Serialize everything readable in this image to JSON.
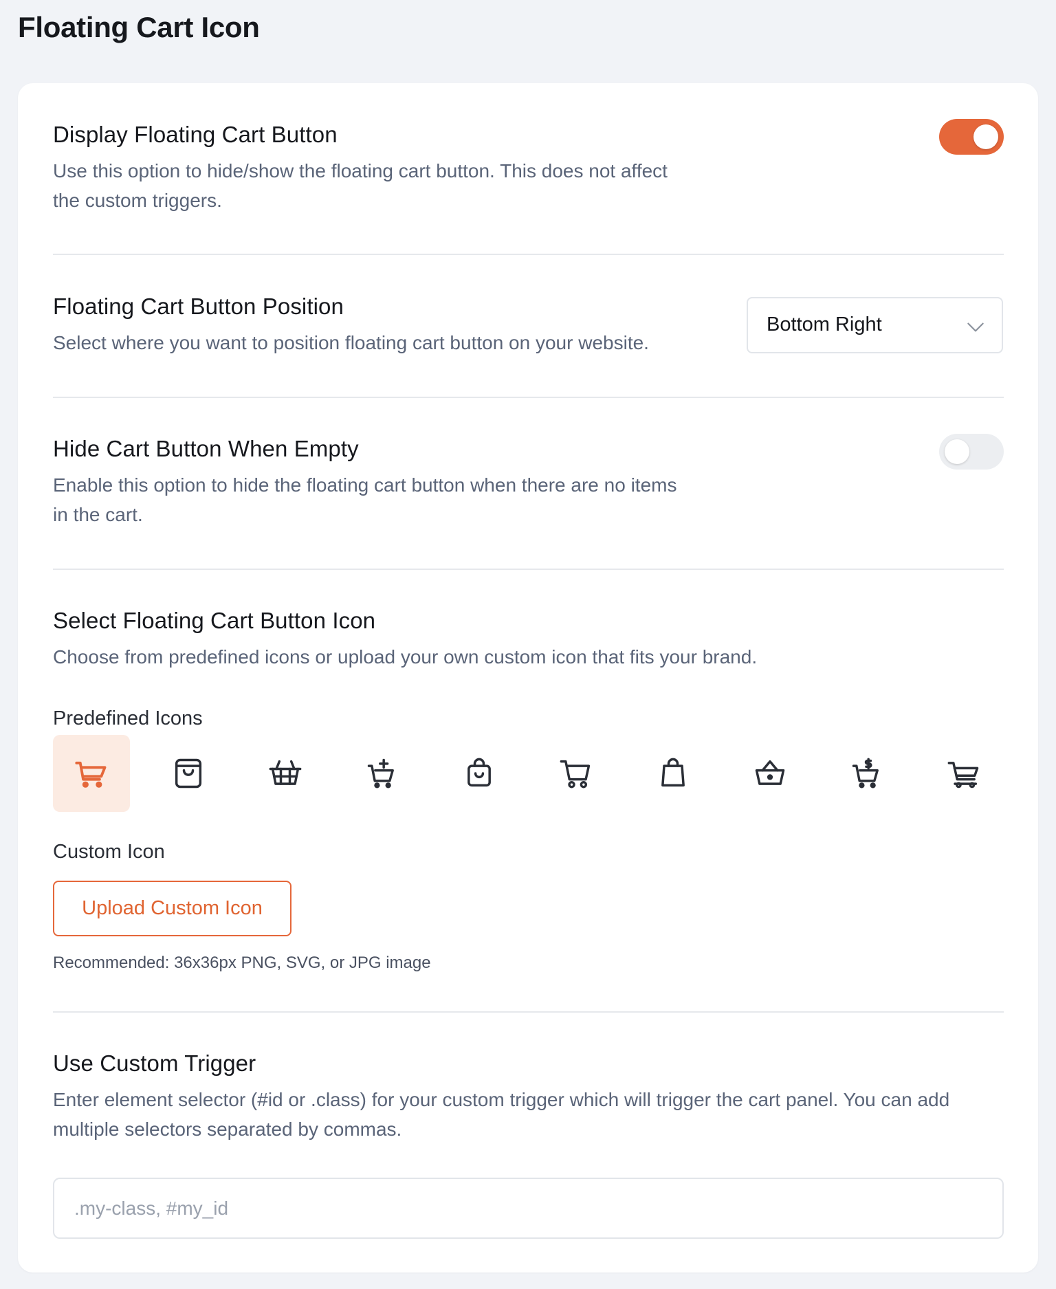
{
  "page": {
    "title": "Floating Cart Icon"
  },
  "colors": {
    "accent": "#e5673a",
    "accent_light": "#fcebe2",
    "muted_text": "#5a6478",
    "background": "#f1f3f7"
  },
  "display_button": {
    "title": "Display Floating Cart Button",
    "description": "Use this option to hide/show the floating cart button. This does not affect the custom triggers.",
    "enabled": true
  },
  "position": {
    "title": "Floating Cart Button Position",
    "description": "Select where you want to position floating cart button on your website.",
    "selected": "Bottom Right"
  },
  "hide_when_empty": {
    "title": "Hide Cart Button When Empty",
    "description": "Enable this option to hide the floating cart button when there are no items in the cart.",
    "enabled": false
  },
  "icon_select": {
    "title": "Select Floating Cart Button Icon",
    "description": "Choose from predefined icons or upload your own custom icon that fits your brand.",
    "predefined_label": "Predefined Icons",
    "icons": [
      "cart-icon",
      "shopping-bag-icon",
      "basket-icon",
      "cart-plus-icon",
      "bag-check-icon",
      "cart-outline-icon",
      "bag-simple-icon",
      "basket-dome-icon",
      "cart-dollar-icon",
      "cart-flat-icon"
    ],
    "selected_index": 0,
    "custom_label": "Custom Icon",
    "upload_label": "Upload Custom Icon",
    "hint": "Recommended: 36x36px PNG, SVG, or JPG image"
  },
  "custom_trigger": {
    "title": "Use Custom Trigger",
    "description": "Enter element selector (#id or .class) for your custom trigger which will trigger the cart panel. You can add multiple selectors separated by commas.",
    "placeholder": ".my-class, #my_id",
    "value": ""
  }
}
